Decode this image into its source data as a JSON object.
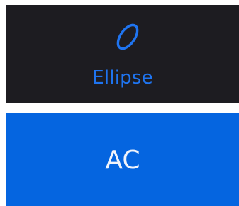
{
  "ellipse_tool": {
    "label": "Ellipse",
    "icon": "ellipse-icon",
    "accent_color": "#1f74f0",
    "background_color": "#1d1c21"
  },
  "ac_button": {
    "label": "AC",
    "background_color": "#0565e0",
    "text_color": "#f1f4fb"
  }
}
